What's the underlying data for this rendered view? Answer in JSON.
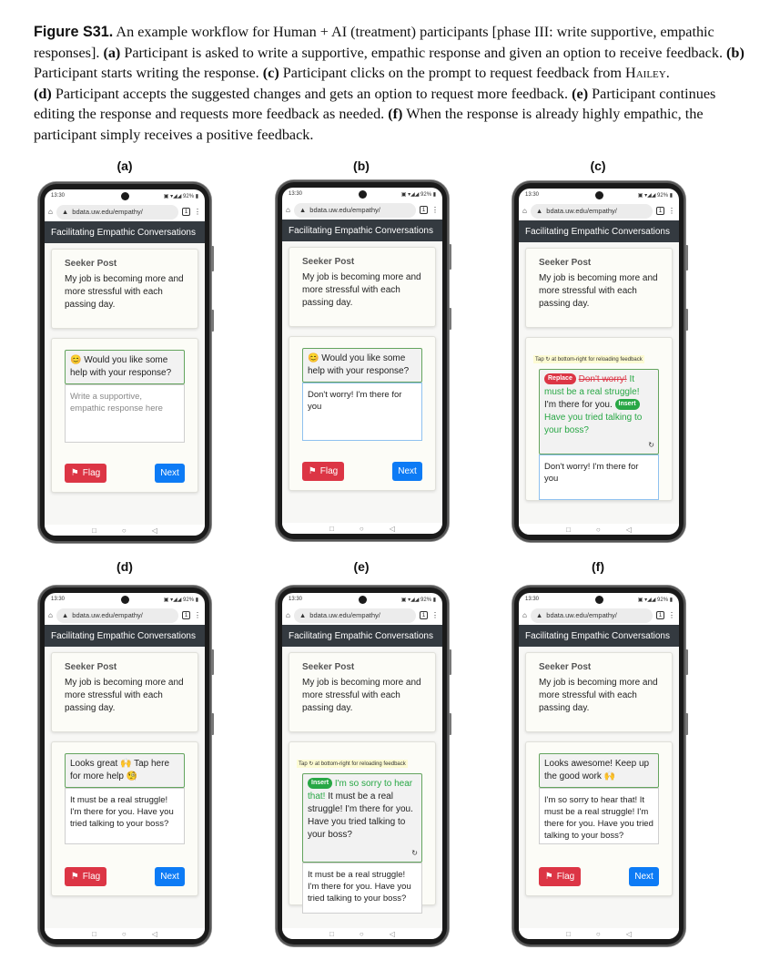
{
  "caption": {
    "label": "Figure S31.",
    "intro": " An example workflow for Human + AI (treatment) participants [phase III: write supportive, empathic responses]. ",
    "steps": [
      {
        "marker": "(a)",
        "text": " Participant is asked to write a supportive, empathic response and given an option to receive feedback. "
      },
      {
        "marker": "(b)",
        "text": " Participant starts writing the response. "
      },
      {
        "marker": "(c)",
        "text": " Participant clicks on the prompt to request feedback from "
      },
      {
        "marker": "(d)",
        "text": " Participant accepts the suggested changes and gets an option to request more feedback. "
      },
      {
        "marker": "(e)",
        "text": " Participant continues editing the response and requests more feedback as needed. "
      },
      {
        "marker": "(f)",
        "text": " When the response is already highly empathic, the participant simply receives a positive feedback."
      }
    ],
    "system_name": "Hailey",
    "system_suffix": "."
  },
  "common": {
    "time": "13:30",
    "battery": "92%",
    "url": "bdata.uw.edu/empathy/",
    "tab_count": "1",
    "app_title": "Facilitating Empathic Conversations",
    "seeker_title": "Seeker Post",
    "seeker_text": "My job is becoming more and more stressful with each passing day.",
    "flag_label": "Flag",
    "next_label": "Next",
    "reload_hint": "Tap ↻ at bottom-right for reloading feedback"
  },
  "panels": {
    "a": {
      "label": "(a)",
      "prompt": "😊 Would you like some help with your response?",
      "placeholder": "Write a supportive, empathic response here"
    },
    "b": {
      "label": "(b)",
      "prompt": "😊 Would you like some help with your response?",
      "response": "Don't worry! I'm there for you"
    },
    "c": {
      "label": "(c)",
      "replace_tag": "Replace",
      "struck": "Don't worry!",
      "replacement": "It must be a real struggle!",
      "kept": "I'm there for you.",
      "insert_tag": "Insert",
      "inserted": "Have you tried talking to your boss?",
      "response": "Don't worry! I'm there for you"
    },
    "d": {
      "label": "(d)",
      "prompt": "Looks great 🙌 Tap here for more help 🧐",
      "response": "It must be a real struggle! I'm there for you. Have you tried talking to your boss?"
    },
    "e": {
      "label": "(e)",
      "insert_tag": "Insert",
      "inserted": "I'm so sorry to hear that!",
      "kept": "It must be a real struggle! I'm there for you. Have you tried talking to your boss?",
      "response": "It must be a real struggle! I'm there for you. Have you tried talking to your boss?"
    },
    "f": {
      "label": "(f)",
      "prompt": "Looks awesome! Keep up the good work 🙌",
      "response": "I'm so sorry to hear that! It must be a real struggle! I'm there for you. Have you tried talking to your boss?"
    }
  }
}
